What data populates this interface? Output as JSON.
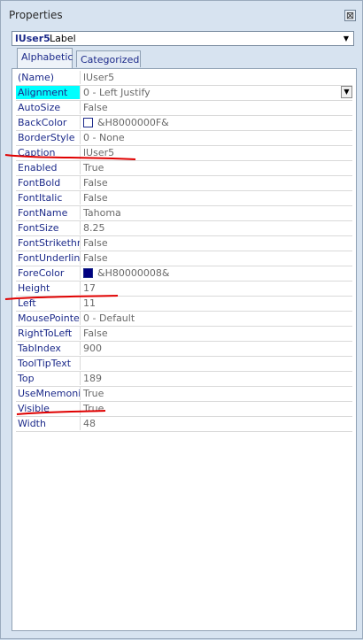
{
  "window": {
    "title": "Properties",
    "close_glyph": "⊠"
  },
  "object_select": {
    "name": "lUser5",
    "type": "Label",
    "dropdown_glyph": "▼"
  },
  "tabs": [
    {
      "label": "Alphabetic",
      "active": true
    },
    {
      "label": "Categorized",
      "active": false
    }
  ],
  "properties": [
    {
      "name": "(Name)",
      "value": "lUser5"
    },
    {
      "name": "Alignment",
      "value": "0 - Left Justify"
    },
    {
      "name": "AutoSize",
      "value": "False"
    },
    {
      "name": "BackColor",
      "value": "&H8000000F&"
    },
    {
      "name": "BorderStyle",
      "value": "0 - None"
    },
    {
      "name": "Caption",
      "value": "lUser5"
    },
    {
      "name": "Enabled",
      "value": "True"
    },
    {
      "name": "FontBold",
      "value": "False"
    },
    {
      "name": "FontItalic",
      "value": "False"
    },
    {
      "name": "FontName",
      "value": "Tahoma"
    },
    {
      "name": "FontSize",
      "value": "8.25"
    },
    {
      "name": "FontStrikethru",
      "value": "False"
    },
    {
      "name": "FontUnderline",
      "value": "False"
    },
    {
      "name": "ForeColor",
      "value": "&H80000008&"
    },
    {
      "name": "Height",
      "value": "17"
    },
    {
      "name": "Left",
      "value": "11"
    },
    {
      "name": "MousePointer",
      "value": "0 - Default"
    },
    {
      "name": "RightToLeft",
      "value": "False"
    },
    {
      "name": "TabIndex",
      "value": "900"
    },
    {
      "name": "ToolTipText",
      "value": ""
    },
    {
      "name": "Top",
      "value": "189"
    },
    {
      "name": "UseMnemonic",
      "value": "True"
    },
    {
      "name": "Visible",
      "value": "True"
    },
    {
      "name": "Width",
      "value": "48"
    }
  ],
  "selected_row": "Alignment",
  "colors": {
    "selection": "#00ffff",
    "backcolor_swatch": "#ffffff",
    "forecolor_swatch": "#000080",
    "annotation": "#e00000"
  }
}
